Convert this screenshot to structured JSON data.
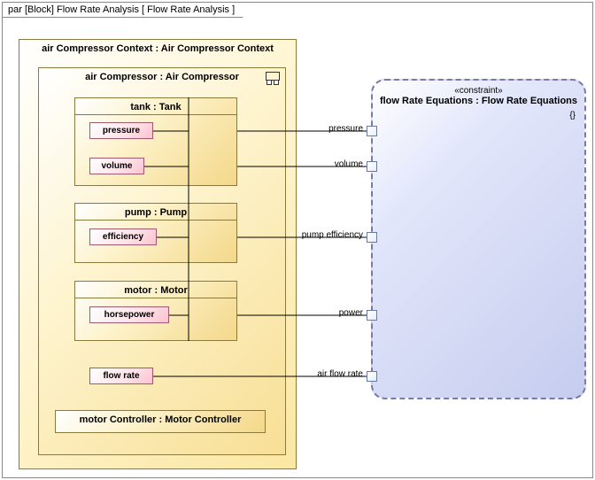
{
  "frame_title": "par [Block] Flow Rate Analysis [ Flow Rate Analysis ]",
  "context": {
    "title": "air Compressor Context : Air Compressor Context",
    "compressor": {
      "title": "air Compressor : Air Compressor",
      "tank": {
        "title": "tank : Tank",
        "pressure": "pressure",
        "volume": "volume"
      },
      "pump": {
        "title": "pump : Pump",
        "efficiency": "efficiency"
      },
      "motor": {
        "title": "motor : Motor",
        "horsepower": "horsepower"
      },
      "flow_rate": "flow rate",
      "motor_controller": {
        "title": "motor Controller : Motor Controller"
      }
    }
  },
  "constraint": {
    "stereotype": "«constraint»",
    "name": "flow Rate Equations : Flow Rate Equations",
    "braces": "{}"
  },
  "ports": {
    "pressure": "pressure",
    "volume": "volume",
    "pump_efficiency": "pump efficiency",
    "power": "power",
    "air_flow_rate": "air flow rate"
  }
}
